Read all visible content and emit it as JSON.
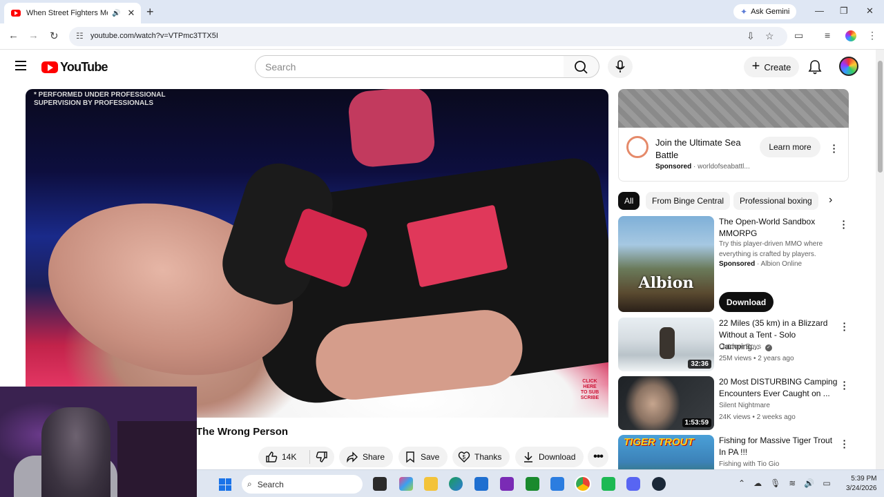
{
  "browser": {
    "tab_title": "When Street Fighters Mess",
    "new_tab": "+",
    "gemini_label": "Ask Gemini",
    "url": "youtube.com/watch?v=VTPmc3TTX5I"
  },
  "youtube": {
    "logo_text": "YouTube",
    "search_placeholder": "Search",
    "create_label": "Create"
  },
  "video": {
    "disclaimer": "* PERFORMED UNDER PROFESSIONAL SUPERVISION BY PROFESSIONALS",
    "corner_tag": "CLICK HERE TO SUB SCRIBE",
    "title": "The Wrong Person",
    "likes": "14K",
    "actions": {
      "share": "Share",
      "save": "Save",
      "thanks": "Thanks",
      "download": "Download"
    }
  },
  "sidebar": {
    "ad": {
      "title": "Join the Ultimate Sea Battle",
      "sponsored": "Sponsored",
      "source": "worldofseabattl...",
      "cta": "Learn more"
    },
    "chips": [
      "All",
      "From Binge Central",
      "Professional boxing"
    ],
    "albion": {
      "title": "The Open-World Sandbox MMORPG",
      "description": "Try this player-driven MMO where everything is crafted by players.",
      "sponsored": "Sponsored",
      "advertiser": "Albion Online",
      "logo_word": "Albion",
      "cta": "Download"
    },
    "recs": [
      {
        "title": "22 Miles (35 km) in a Blizzard Without a Tent - Solo Camping...",
        "channel": "Outdoor Boys",
        "meta": "25M views • 2 years ago",
        "duration": "32:36"
      },
      {
        "title": "20 Most DISTURBING Camping Encounters Ever Caught on ...",
        "channel": "Silent Nightmare",
        "meta": "24K views • 2 weeks ago",
        "duration": "1:53:59"
      },
      {
        "title": "Fishing for Massive Tiger Trout In PA !!!",
        "channel": "Fishing with Tio Gio",
        "meta": "",
        "duration": "",
        "thumb_text": "TIGER TROUT"
      }
    ]
  },
  "taskbar": {
    "search_label": "Search",
    "time": "5:39 PM",
    "date": "3/24/2026"
  },
  "colors": {
    "yt_red": "#ff0000",
    "chip_active": "#0f0f0f",
    "taskbar": "#dfe6f1"
  }
}
